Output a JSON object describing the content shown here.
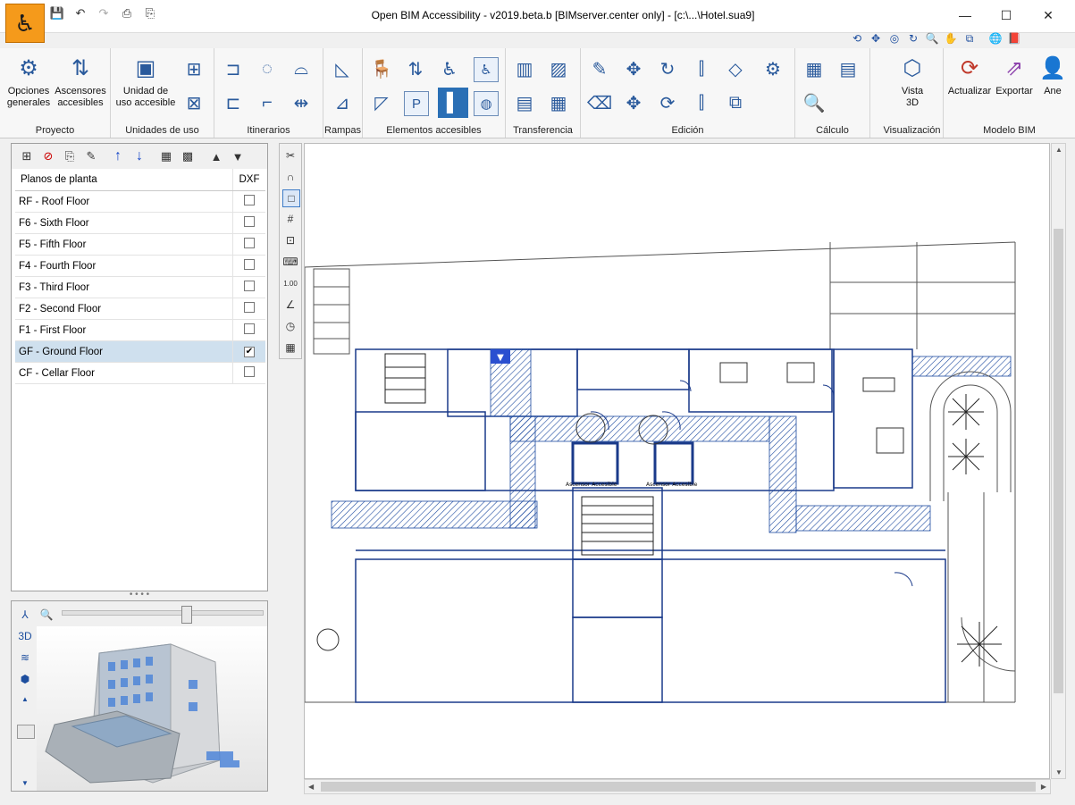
{
  "window": {
    "title": "Open BIM Accessibility - v2019.beta.b [BIMserver.center only] - [c:\\...\\Hotel.sua9]",
    "minimize": "—",
    "maximize": "☐",
    "close": "✕"
  },
  "quick_access": [
    "save-icon",
    "undo-icon",
    "redo-icon",
    "print-icon",
    "print-preview-icon"
  ],
  "ribbon": {
    "proyecto": {
      "label": "Proyecto",
      "opciones": "Opciones\ngenerales",
      "ascensores": "Ascensores\naccesibles"
    },
    "unidades": {
      "label": "Unidades de uso",
      "unidad": "Unidad de\nuso accesible"
    },
    "itinerarios": {
      "label": "Itinerarios"
    },
    "rampas": {
      "label": "Rampas"
    },
    "elementos": {
      "label": "Elementos accesibles"
    },
    "transferencia": {
      "label": "Transferencia"
    },
    "edicion": {
      "label": "Edición"
    },
    "calculo": {
      "label": "Cálculo"
    },
    "visualizacion": {
      "label": "Visualización",
      "vista": "Vista\n3D"
    },
    "modelo": {
      "label": "Modelo BIM",
      "actualizar": "Actualizar",
      "exportar": "Exportar",
      "ane": "Ane"
    }
  },
  "floors": {
    "header": "Planos de planta",
    "dxf_header": "DXF",
    "rows": [
      {
        "name": "RF - Roof Floor",
        "dxf": false
      },
      {
        "name": "F6 - Sixth Floor",
        "dxf": false
      },
      {
        "name": "F5 - Fifth Floor",
        "dxf": false
      },
      {
        "name": "F4 - Fourth Floor",
        "dxf": false
      },
      {
        "name": "F3 - Third Floor",
        "dxf": false
      },
      {
        "name": "F2 - Second Floor",
        "dxf": false
      },
      {
        "name": "F1 - First Floor",
        "dxf": false
      },
      {
        "name": "GF - Ground Floor",
        "dxf": true,
        "selected": true
      },
      {
        "name": "CF - Cellar Floor",
        "dxf": false
      }
    ]
  },
  "plan": {
    "labels": [
      "Ascensor Accesible",
      "Ascensor Accesible"
    ]
  },
  "colors": {
    "accent": "#2a6fb5",
    "plan_line": "#1a3a8a",
    "app_icon": "#f59a1b"
  }
}
